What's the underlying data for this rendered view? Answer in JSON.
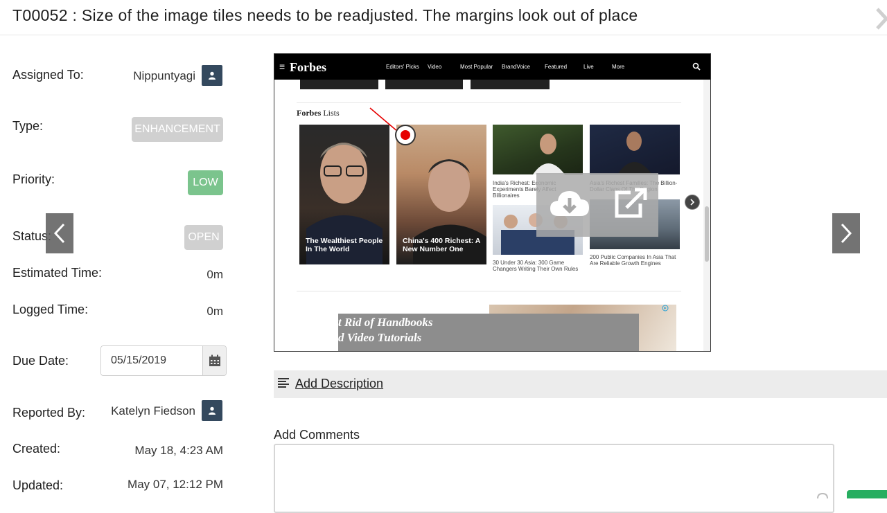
{
  "task": {
    "title": "T00052 : Size of the image tiles needs to be readjusted. The margins look out of place"
  },
  "fields": {
    "assigned_to": {
      "label": "Assigned To:",
      "value": "Nippuntyagi"
    },
    "type": {
      "label": "Type:",
      "value": "ENHANCEMENT"
    },
    "priority": {
      "label": "Priority:",
      "value": "LOW"
    },
    "status": {
      "label": "Status:",
      "value": "OPEN"
    },
    "estimated_time": {
      "label": "Estimated Time:",
      "value": "0m"
    },
    "logged_time": {
      "label": "Logged Time:",
      "value": "0m"
    },
    "due_date": {
      "label": "Due Date:",
      "value": "05/15/2019"
    },
    "reported_by": {
      "label": "Reported By:",
      "value": "Katelyn Fiedson"
    },
    "created": {
      "label": "Created:",
      "value": "May 18, 4:23 AM"
    },
    "updated": {
      "label": "Updated:",
      "value": "May 07, 12:12 PM"
    }
  },
  "attachment": {
    "logo": "Forbes",
    "nav": [
      "Editors' Picks",
      "Video",
      "Most Popular",
      "BrandVoice",
      "Featured",
      "Live",
      "More"
    ],
    "lists_title_brand": "Forbes",
    "lists_title_rest": "Lists",
    "cards": [
      {
        "caption": "The Wealthiest People In The World"
      },
      {
        "caption": "China's 400 Richest: A New Number One"
      },
      {
        "caption": "India's Richest: Economic Experiments Barely Affect Billionaires"
      },
      {
        "caption": "Asia's Richest Families: The Billion-Dollar Clans Of The Region"
      },
      {
        "caption": "30 Under 30 Asia: 300 Game Changers Writing Their Own Rules"
      },
      {
        "caption": "200 Public Companies In Asia That Are Reliable Growth Engines"
      }
    ],
    "ad_line1": "t Rid of Handbooks",
    "ad_line2": "d Video Tutorials"
  },
  "description": {
    "link": "Add Description"
  },
  "comments": {
    "label": "Add Comments",
    "placeholder": ""
  },
  "icons": {
    "user": "user-icon",
    "calendar": "calendar-icon",
    "prev": "chevron-left-icon",
    "next": "chevron-right-icon",
    "download": "cloud-download-icon",
    "open": "external-link-icon",
    "description": "lines-icon"
  },
  "colors": {
    "user_button": "#34495e",
    "low_priority": "#7bc48d",
    "pill_gray": "#d0d0d0",
    "marker_red": "#e60000",
    "send_green": "#27ae60"
  }
}
